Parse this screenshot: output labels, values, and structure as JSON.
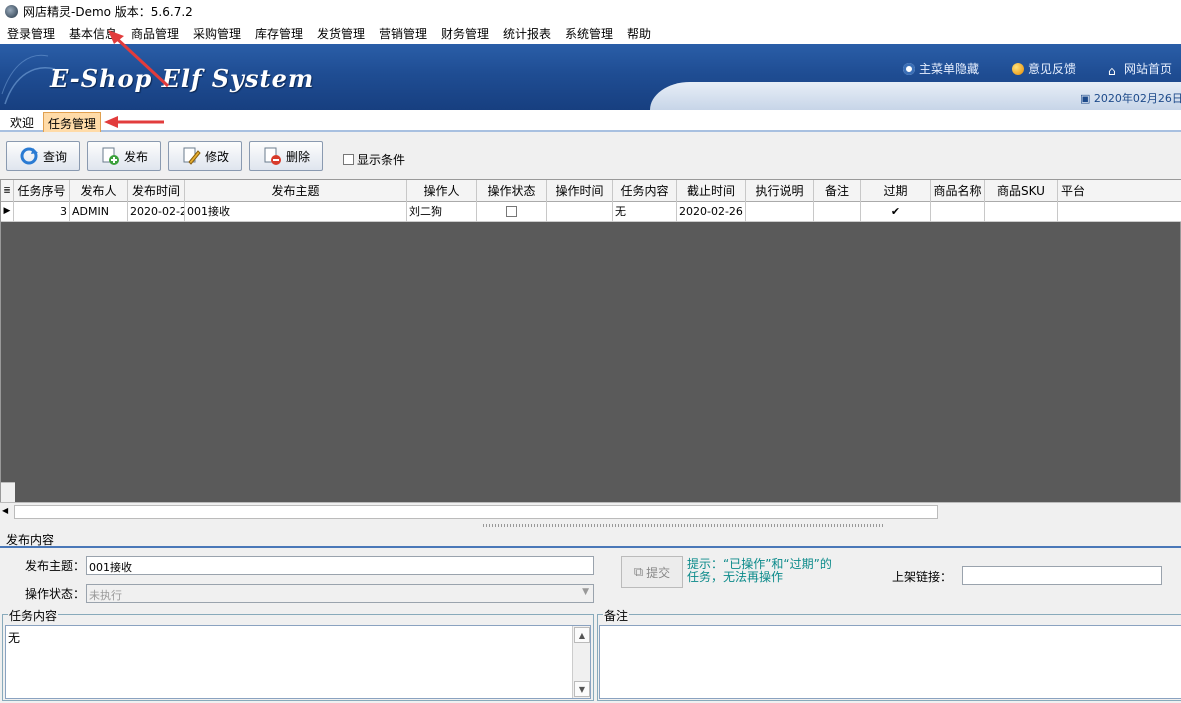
{
  "window": {
    "title": "网店精灵-Demo  版本：5.6.7.2"
  },
  "menubar": {
    "items": [
      "登录管理",
      "基本信息",
      "商品管理",
      "采购管理",
      "库存管理",
      "发货管理",
      "营销管理",
      "财务管理",
      "统计报表",
      "系统管理",
      "帮助"
    ]
  },
  "banner": {
    "logo_text": "E-Shop Elf System",
    "links": {
      "hide_menu": "主菜单隐藏",
      "feedback": "意见反馈",
      "home": "网站首页"
    },
    "date": "2020年02月26日"
  },
  "tabs": [
    {
      "label": "欢迎",
      "active": false
    },
    {
      "label": "任务管理",
      "active": true
    }
  ],
  "toolbar": {
    "query": "查询",
    "publish": "发布",
    "edit": "修改",
    "delete": "删除",
    "show_conditions": "显示条件",
    "show_conditions_checked": false
  },
  "grid": {
    "columns": [
      "任务序号",
      "发布人",
      "发布时间",
      "发布主题",
      "操作人",
      "操作状态",
      "操作时间",
      "任务内容",
      "截止时间",
      "执行说明",
      "备注",
      "过期",
      "商品名称",
      "商品SKU",
      "平台"
    ],
    "rows": [
      {
        "id": "3",
        "publisher": "ADMIN",
        "publish_time": "2020-02-2",
        "subject": "001接收",
        "operator": "刘二狗",
        "op_status_checked": false,
        "op_time": "",
        "content": "无",
        "deadline": "2020-02-26",
        "exec_note": "",
        "remark": "",
        "expired_checked": true,
        "product_name": "",
        "sku": "",
        "platform": ""
      }
    ]
  },
  "detail": {
    "section_title": "发布内容",
    "subject_label": "发布主题：",
    "subject_value": "001接收",
    "status_label": "操作状态：",
    "status_value": "未执行",
    "submit_label": "提交",
    "hint_line1": "提示：“已操作”和“过期”的",
    "hint_line2": "任务，无法再操作",
    "listing_link_label": "上架链接：",
    "listing_link_value": "",
    "content_group_label": "任务内容",
    "content_value": "无",
    "remark_group_label": "备注",
    "remark_value": ""
  }
}
